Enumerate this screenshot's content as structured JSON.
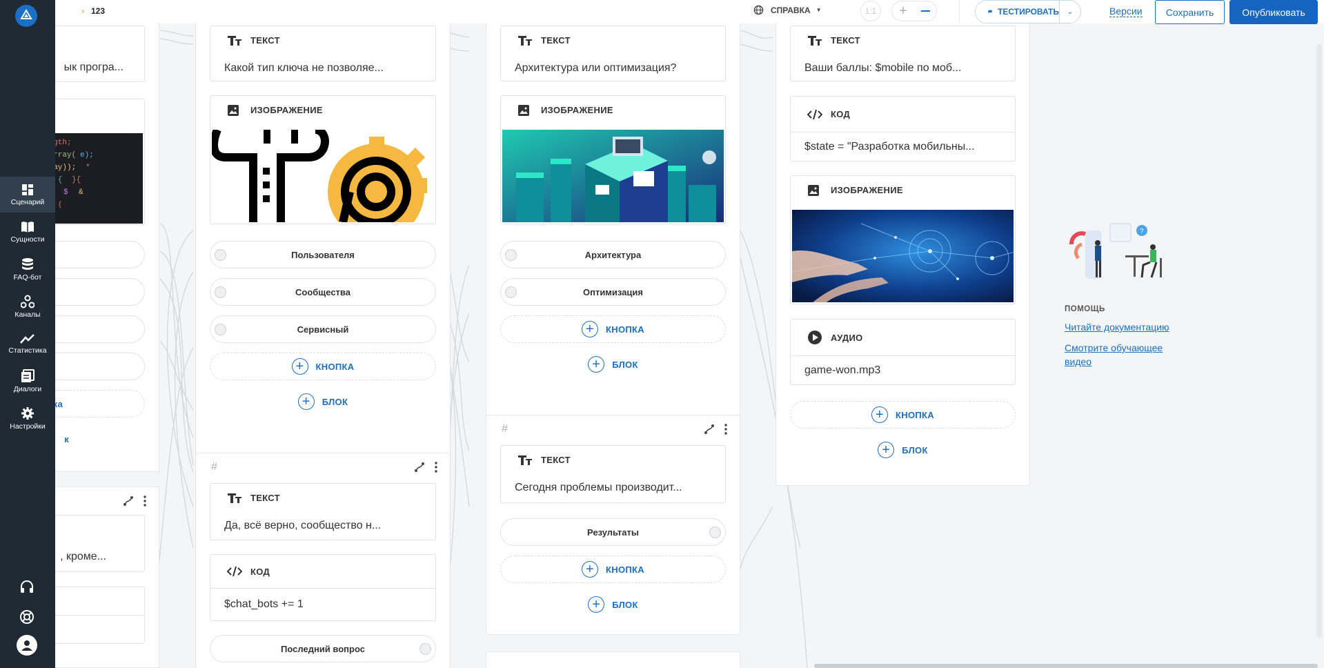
{
  "breadcrumb": {
    "chevron": "›",
    "name": "123"
  },
  "topbar": {
    "help_label": "СПРАВКА",
    "zoom_label": "1:1",
    "test_label": "ТЕСТИРОВАТЬ",
    "versions_label": "Версии",
    "save_label": "Сохранить",
    "publish_label": "Опубликовать"
  },
  "sidebar": {
    "items": [
      {
        "label": "Сценарий",
        "icon": "dashboard-icon"
      },
      {
        "label": "Сущности",
        "icon": "book-icon"
      },
      {
        "label": "FAQ-бот",
        "icon": "database-icon"
      },
      {
        "label": "Каналы",
        "icon": "channels-icon"
      },
      {
        "label": "Статистика",
        "icon": "trend-icon"
      },
      {
        "label": "Диалоги",
        "icon": "dialogs-icon"
      },
      {
        "label": "Настройки",
        "icon": "gear-icon"
      }
    ]
  },
  "labels": {
    "text": "ТЕКСТ",
    "image": "ИЗОБРАЖЕНИЕ",
    "code": "КОД",
    "audio": "АУДИО",
    "button": "КНОПКА",
    "block": "БЛОК",
    "hash": "#"
  },
  "col0": {
    "text_fragment": "ык програ...",
    "button_fragment": "ка",
    "block_fragment": "к",
    "text2_fragment": ", кроме..."
  },
  "col1": {
    "card1": {
      "text": "Какой тип ключа не позволяе...",
      "buttons": [
        "Пользователя",
        "Сообщества",
        "Сервисный"
      ]
    },
    "card2": {
      "text": "Да, всё верно, сообщество н...",
      "code": "$chat_bots += 1",
      "button": "Последний вопрос"
    }
  },
  "col2": {
    "card1": {
      "text": "Архитектура или оптимизация?",
      "buttons": [
        "Архитектура",
        "Оптимизация"
      ]
    },
    "card2": {
      "text": "Сегодня проблемы производит...",
      "button": "Результаты"
    }
  },
  "col3": {
    "text": "Ваши баллы:  $mobile по моб...",
    "code": "$state = \"Разработка мобильны...",
    "audio": "game-won.mp3"
  },
  "help": {
    "title": "ПОМОЩЬ",
    "link1": "Читайте документацию",
    "link2": "Смотрите обучающее видео"
  },
  "colors": {
    "sidebar": "#1f2a35",
    "accent": "#1b6fc7",
    "publish": "#1565c0"
  }
}
